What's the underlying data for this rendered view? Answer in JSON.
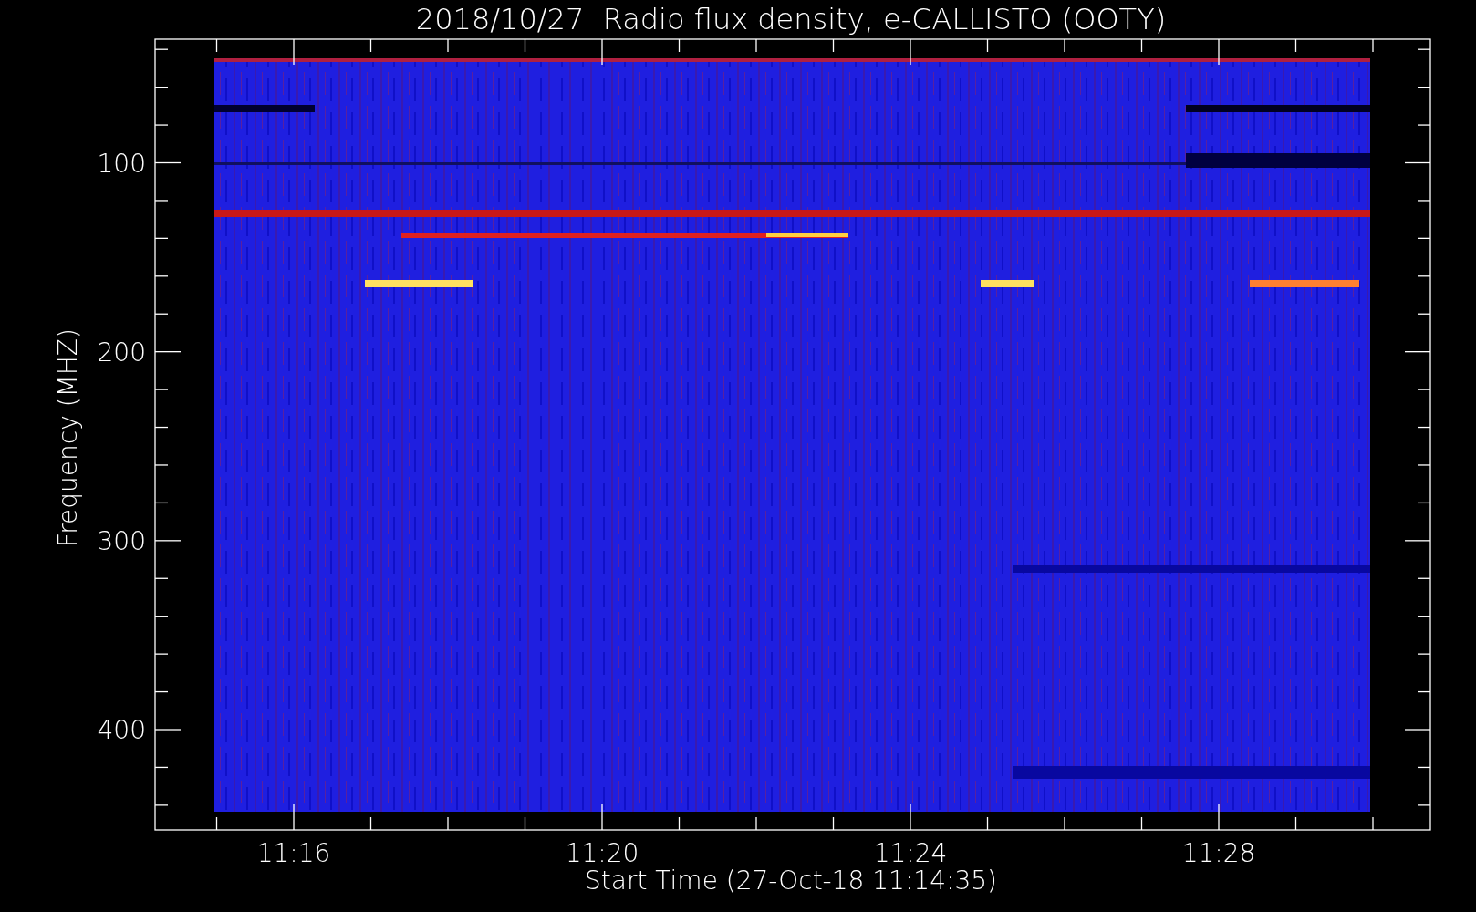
{
  "plot": {
    "title": "2018/10/27  Radio flux density, e-CALLISTO (OOTY)",
    "xlabel": "Start Time (27-Oct-18 11:14:35)",
    "ylabel": "Frequency (MHZ)",
    "xticks": [
      "11:16",
      "11:20",
      "11:24",
      "11:28"
    ],
    "yticks": [
      "100",
      "200",
      "300",
      "400"
    ]
  }
}
